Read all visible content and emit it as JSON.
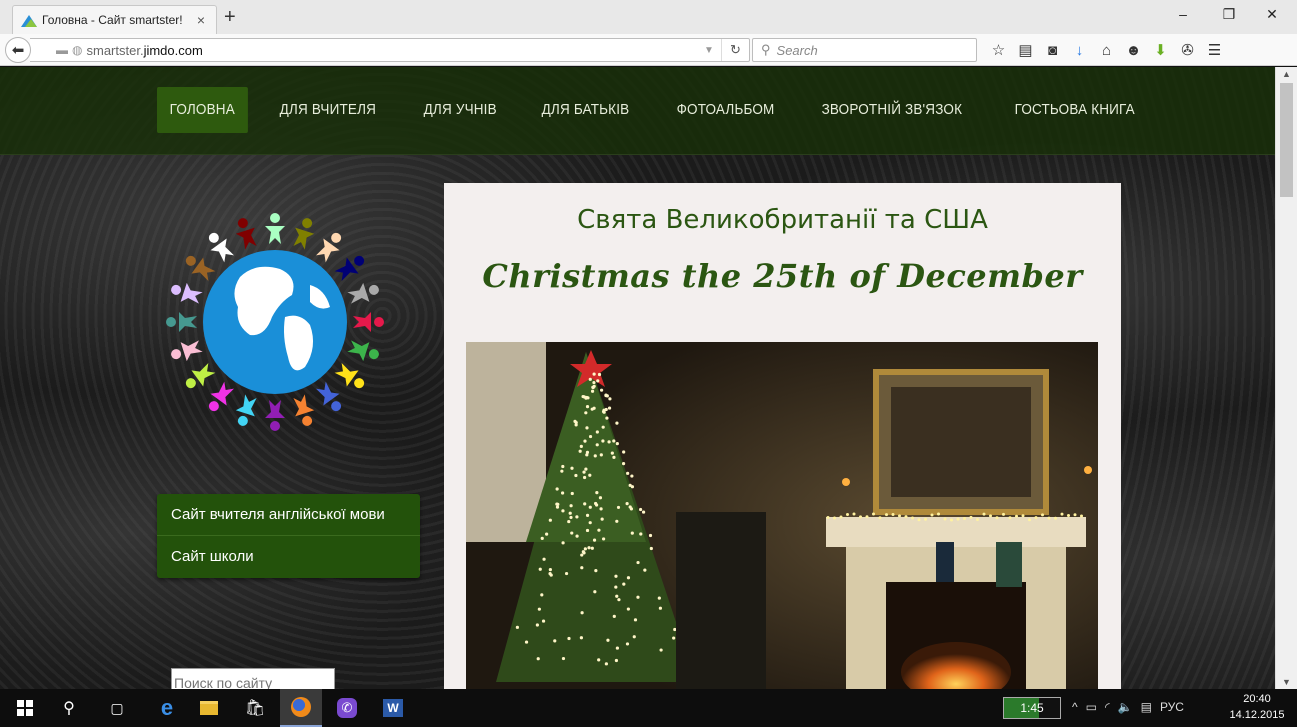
{
  "browser": {
    "tab": {
      "title": "Головна - Сайт smartster!",
      "close": "×"
    },
    "newtab": "+",
    "window": {
      "minimize": "–",
      "restore": "❐",
      "close": "✕"
    },
    "url": {
      "prefix": "smartster.",
      "domain": "jimdo.com"
    },
    "search_placeholder": "Search",
    "toolbar_icons": [
      "star-icon",
      "reading-list-icon",
      "pocket-icon",
      "download-icon",
      "home-icon",
      "chat-icon",
      "addon-download-icon",
      "extension-icon",
      "menu-icon"
    ]
  },
  "site": {
    "nav": [
      {
        "label": "Головна",
        "active": true
      },
      {
        "label": "Для вчителя"
      },
      {
        "label": "Для учнів"
      },
      {
        "label": "Для батьків"
      },
      {
        "label": "Фотоальбом"
      },
      {
        "label": "Зворотній зв'язок"
      },
      {
        "label": "Гостьова книга"
      }
    ],
    "side_links": [
      "Сайт вчителя англійської мови",
      "Сайт школи"
    ],
    "search_placeholder": "Поиск по сайту",
    "heading": "Свята Великобританії та США",
    "subheading": "Christmas the 25th of December"
  },
  "taskbar": {
    "battery": {
      "label": "1:45",
      "level": 0.62
    },
    "language": "РУС",
    "time": "20:40",
    "date": "14.12.2015"
  },
  "colors": {
    "nav_bg": "#183008",
    "nav_active": "#2e5a0e",
    "side_menu": "#23520b",
    "heading_green": "#2b5612",
    "content_bg": "#f3efee"
  }
}
